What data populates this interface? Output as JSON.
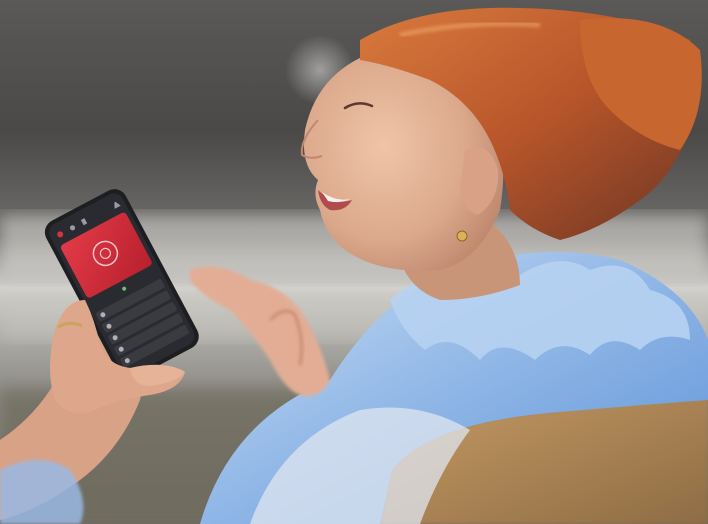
{
  "photo": {
    "subject": "woman-with-smartphone",
    "colors": {
      "hair": "#c8622e",
      "skin": "#e7b79b",
      "blouse": "#8fb6e6",
      "background_dark": "#3e3d3c",
      "background_light": "#cbcbc8",
      "sofa": "#b48a58",
      "phone_body": "#1d1e22",
      "phone_accent": "#d8323f"
    }
  },
  "phone_screen": {
    "accent_color": "#d8323f",
    "list_items_count": 5,
    "icons": [
      "record-icon",
      "settings-icon",
      "music-icon",
      "bell-icon",
      "microphone-icon"
    ]
  }
}
